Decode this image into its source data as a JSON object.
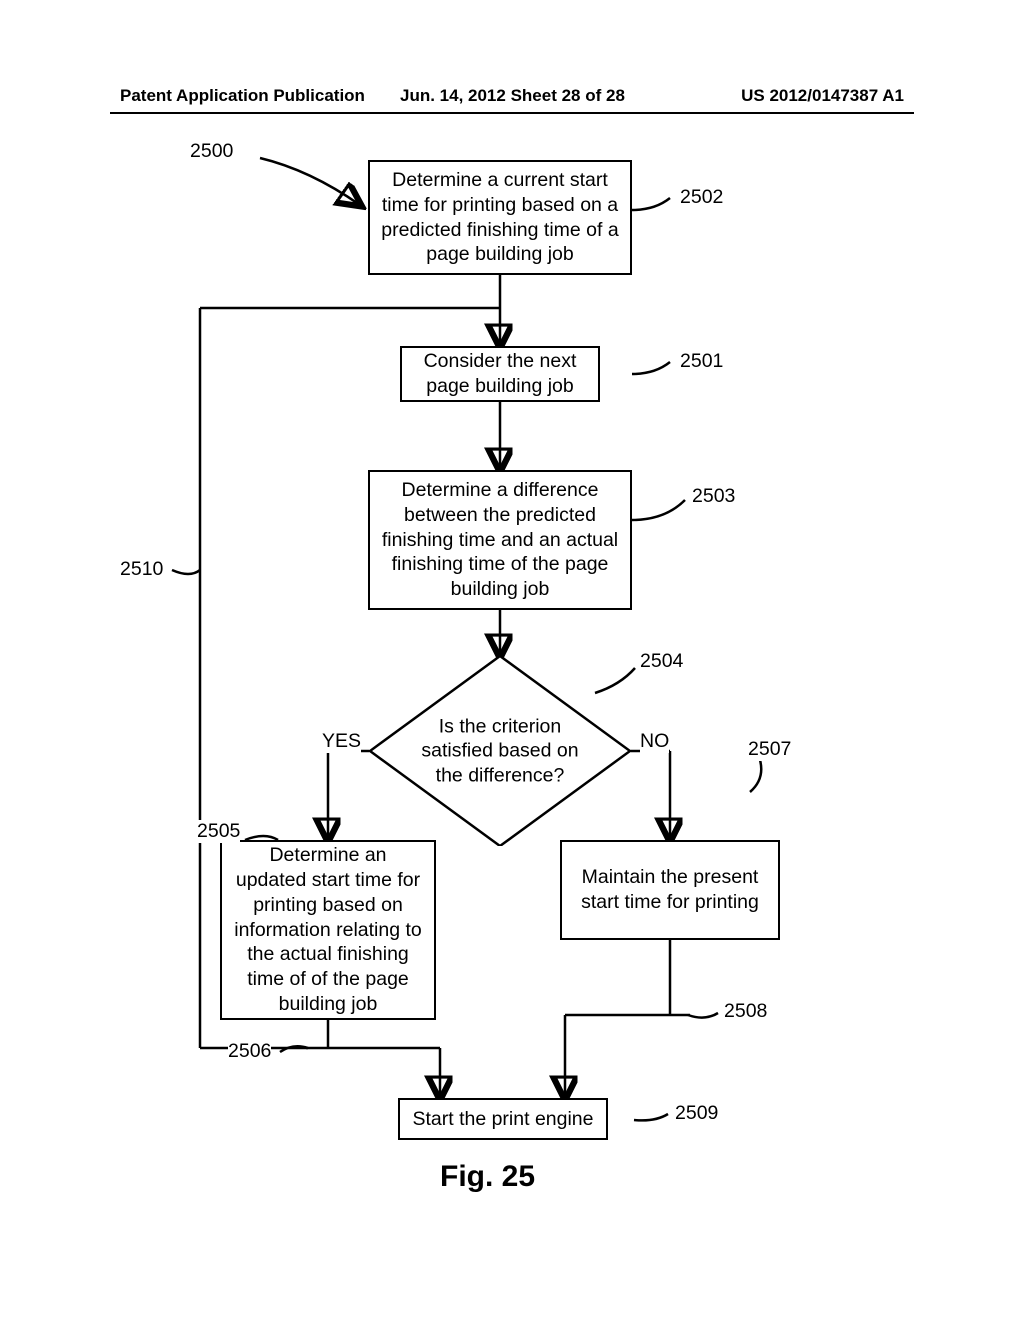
{
  "header": {
    "left": "Patent Application Publication",
    "center": "Jun. 14, 2012  Sheet 28 of 28",
    "right": "US 2012/0147387 A1"
  },
  "flowchart": {
    "entry_ref": "2500",
    "boxes": {
      "b2502": {
        "text": "Determine a current start time for printing based on a predicted finishing time of a page building job",
        "ref": "2502"
      },
      "b2501": {
        "text": "Consider the next page building job",
        "ref": "2501"
      },
      "b2503": {
        "text": "Determine a difference between the predicted finishing time and an actual finishing time of the page building job",
        "ref": "2503"
      },
      "d2504": {
        "text": "Is the criterion satisfied based on the difference?",
        "ref": "2504",
        "yes": "YES",
        "no": "NO"
      },
      "b2505": {
        "text": "Determine an updated start time for printing based on information relating to the actual finishing time of of the page building job",
        "ref": "2505"
      },
      "b2507": {
        "text": "Maintain the present start time for printing",
        "ref": "2507"
      },
      "b2509": {
        "text": "Start the print engine",
        "ref": "2509"
      }
    },
    "extra_refs": {
      "r2506": "2506",
      "r2508": "2508",
      "r2510": "2510"
    }
  },
  "figure_caption": "Fig. 25"
}
